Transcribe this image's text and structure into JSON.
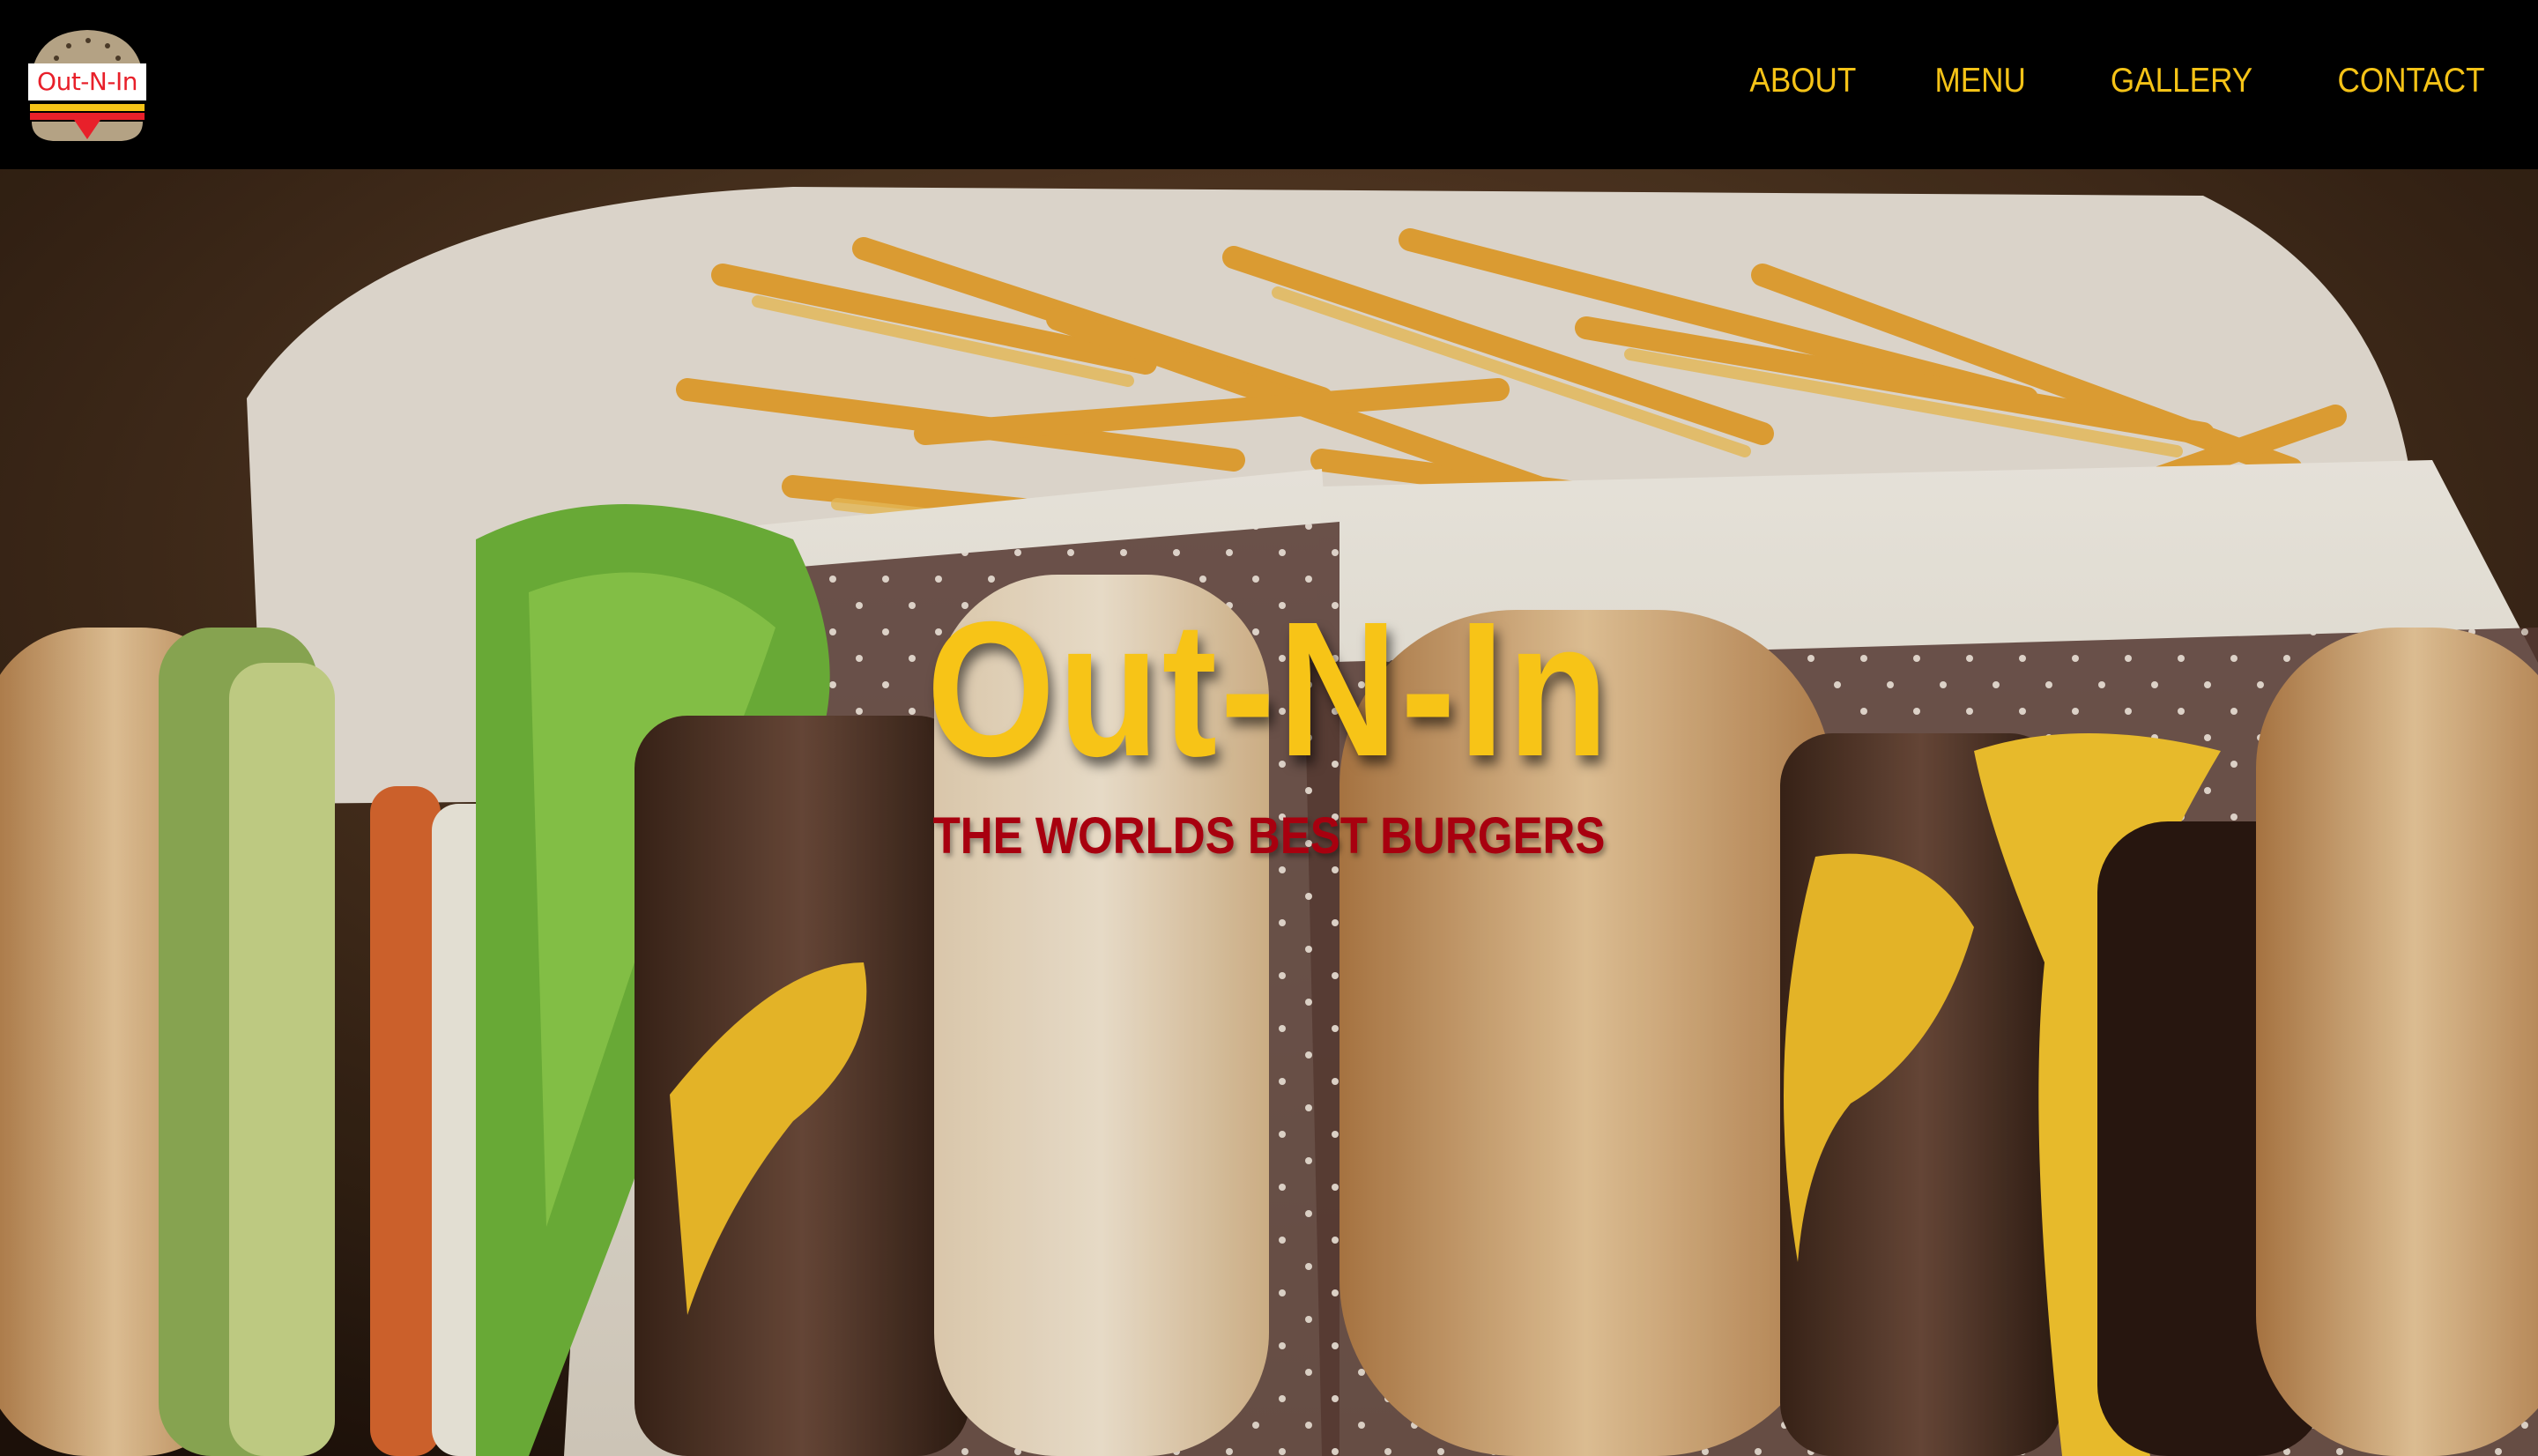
{
  "brand": {
    "logo_text": "Out-N-In",
    "colors": {
      "accent": "#f5c317",
      "tagline": "#a8000f",
      "header_bg": "#000000"
    }
  },
  "nav": {
    "items": [
      {
        "label": "ABOUT"
      },
      {
        "label": "MENU"
      },
      {
        "label": "GALLERY"
      },
      {
        "label": "CONTACT"
      }
    ]
  },
  "hero": {
    "title": "Out-N-In",
    "subtitle": "THE WORLDS BEST BURGERS",
    "background_image": "burgers-and-fries-photo"
  }
}
